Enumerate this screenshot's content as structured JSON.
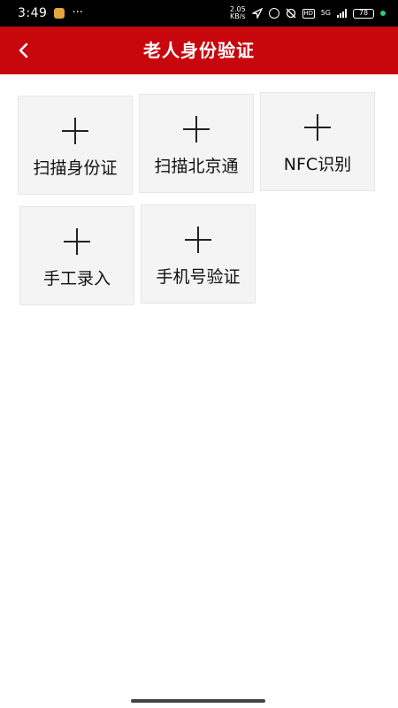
{
  "status_bar": {
    "time": "3:49",
    "dots": "···",
    "speed_value": "2.05",
    "speed_unit": "KB/s",
    "hd_badge": "HD",
    "network": "5G",
    "battery": "78"
  },
  "header": {
    "title": "老人身份验证",
    "background_color": "#c8070d"
  },
  "options": [
    {
      "label": "扫描身份证",
      "icon": "plus-icon"
    },
    {
      "label": "扫描北京通",
      "icon": "plus-icon"
    },
    {
      "label": "NFC识别",
      "icon": "plus-icon"
    },
    {
      "label": "手工录入",
      "icon": "plus-icon"
    },
    {
      "label": "手机号验证",
      "icon": "plus-icon"
    }
  ]
}
